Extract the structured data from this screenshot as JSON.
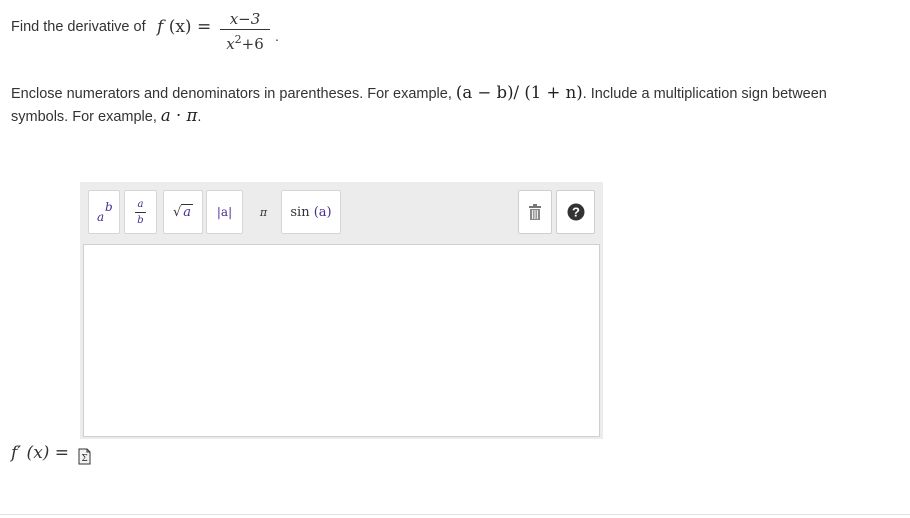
{
  "question": {
    "prefix": "Find the derivative of",
    "function_name": "f",
    "function_arg": "(x)",
    "equals": "=",
    "numerator": "x−3",
    "denominator_base": "x",
    "denominator_exp": "2",
    "denominator_rest": "+6",
    "end": "."
  },
  "instructions": {
    "line1_text": "Enclose numerators and denominators in parentheses. For example,",
    "example1": "(a − b)/ (1 + n)",
    "line1_end": ". Include a multiplication sign between",
    "line2_text": "symbols. For example,",
    "example2": "a · π",
    "line2_end": "."
  },
  "toolbar": {
    "power_base": "a",
    "power_exp": "b",
    "fraction_num": "a",
    "fraction_den": "b",
    "sqrt_symbol": "√",
    "sqrt_arg": "a",
    "abs_label": "|a|",
    "pi_label": "π",
    "sin_fn": "sin",
    "sin_arg": "(a)",
    "trash_icon": "trash-icon",
    "help_icon": "help-icon"
  },
  "answer": {
    "label": "f′ (x) =",
    "input_value": ""
  },
  "colors": {
    "accent": "#4a2c8f",
    "editor_bg": "#ececec",
    "help_bg": "#333333"
  }
}
